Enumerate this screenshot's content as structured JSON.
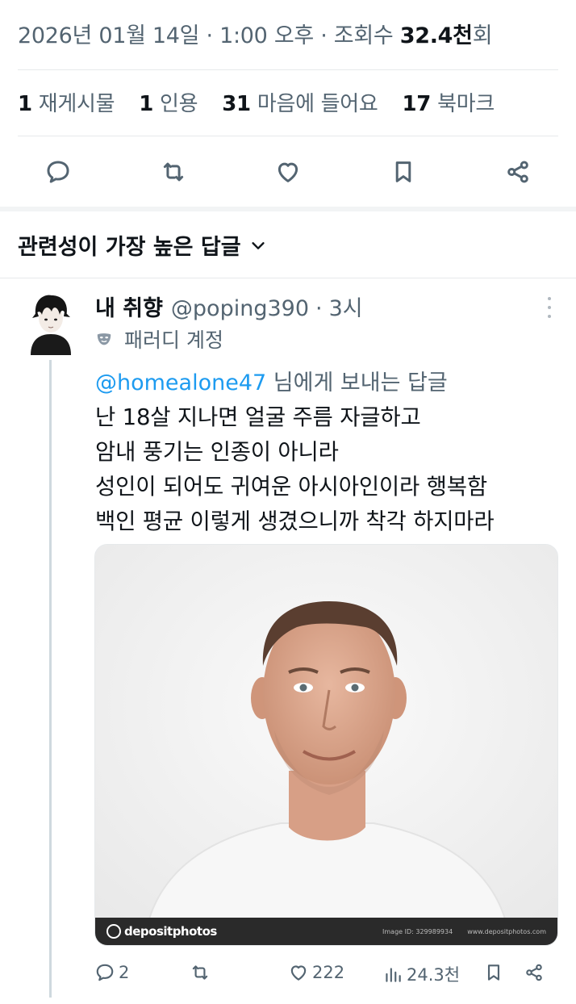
{
  "post": {
    "date": "2026년 01월 14일",
    "sep1": "·",
    "time": "1:00 오후",
    "sep2": "·",
    "views_label": "조회수",
    "views_value": "32.4천",
    "views_suffix": "회"
  },
  "stats": {
    "reposts_num": "1",
    "reposts_label": "재게시물",
    "quotes_num": "1",
    "quotes_label": "인용",
    "likes_num": "31",
    "likes_label": "마음에 들어요",
    "bookmarks_num": "17",
    "bookmarks_label": "북마크"
  },
  "actions": [
    "reply-icon",
    "repost-icon",
    "like-icon",
    "bookmark-icon",
    "share-icon"
  ],
  "sort": {
    "label": "관련성이 가장 높은 답글"
  },
  "reply": {
    "display_name": "내 취향",
    "handle": "@poping390",
    "sep": "·",
    "time": "3시",
    "parody_label": "패러디 계정",
    "replying_mention": "@homealone47",
    "replying_suffix": " 님에게 보내는 답글",
    "lines": [
      "난 18살 지나면 얼굴 주름 자글하고",
      "암내 풍기는 인종이 아니라",
      "성인이 되어도 귀여운 아시아인이라 행복함",
      "백인 평균 이렇게 생겼으니까 착각 하지마라"
    ],
    "media": {
      "watermark": "depositphotos",
      "image_id": "Image ID: 329989934",
      "site": "www.depositphotos.com"
    },
    "counts": {
      "replies": "2",
      "reposts": "",
      "likes": "222",
      "views": "24.3천"
    }
  },
  "colors": {
    "text_primary": "#0f1419",
    "text_secondary": "#536471",
    "link": "#1d9bf0",
    "divider": "#e6e9eb"
  }
}
